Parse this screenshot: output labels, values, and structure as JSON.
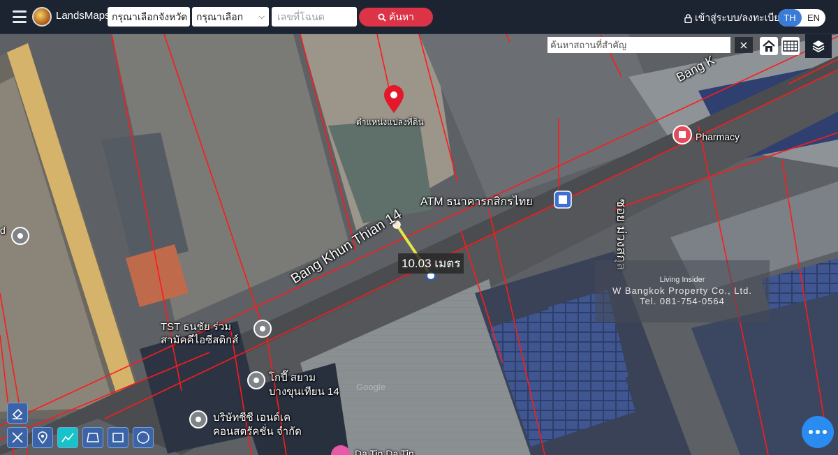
{
  "header": {
    "brand": "LandsMaps",
    "province_select": "กรุณาเลือกจังหวัด",
    "district_select": "กรุณาเลือกอำเภอ",
    "deed_placeholder": "เลขที่โฉนด",
    "search_label": "ค้นหา",
    "login_label": "เข้าสู่ระบบ/ลงทะเบียน",
    "lang_th": "TH",
    "lang_en": "EN"
  },
  "map": {
    "place_search_placeholder": "ค้นหาสถานที่สำคัญ",
    "clear_symbol": "×",
    "pin_label": "ตำแหน่งแปลงที่ดิน",
    "street_main": "Bang Khun Thian 14",
    "street_top": "Bang K",
    "soi_label": "ซอย ม่วงสกุล",
    "poi_pharmacy": "Pharmacy",
    "poi_atm": "ATM ธนาคารกสิกรไทย",
    "poi_tst_line1": "TST ธนชัย ร่วม",
    "poi_tst_line2": "สามัคคีไอซีสติกส์",
    "poi_kopi_line1": "โกปี๊ สยาม",
    "poi_kopi_line2": "บางขุนเทียน 14",
    "poi_company_line1": "บริษัทซีซี เอนด์เค",
    "poi_company_line2": "คอนสตรัคชั่น จำกัด",
    "poi_bottom": "Da Tin Da Tin",
    "left_edge_label": "d",
    "google_mark": "Google",
    "measurement": "10.03 เมตร",
    "watermark_line1": "Living Insider",
    "watermark_line2": "W Bangkok Property Co., Ltd.",
    "watermark_line3": "Tel. 081-754-0564"
  },
  "colors": {
    "header_bg": "#1c2431",
    "search_button": "#dc3446",
    "lang_active": "#3a7bd5",
    "parcel_lines": "#ff1a1a",
    "pin": "#e3192b",
    "tool_active": "#16c3c9",
    "tool_bg": "#3a63a8",
    "fab": "#2a8cf0"
  }
}
